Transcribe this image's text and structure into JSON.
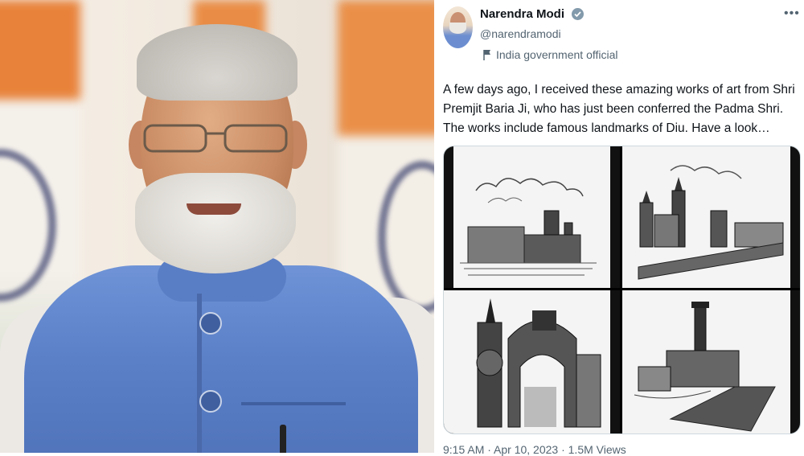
{
  "portrait": {
    "alt_subject": ""
  },
  "tweet": {
    "author_name": "Narendra Modi",
    "handle": "@narendramodi",
    "label": "India government official",
    "text": "A few days ago, I received these amazing works of art from Shri Premjit Baria Ji, who has just been conferred the Padma Shri. The works include famous landmarks of Diu. Have a look…",
    "timestamp": "9:15 AM · Apr 10, 2023 · 1.5M Views"
  },
  "icons": {
    "verified": "verified-badge-icon",
    "flag": "flag-icon",
    "more": "more-icon"
  },
  "colors": {
    "text": "#0f1419",
    "secondary": "#536471",
    "verified_badge": "#829aab",
    "jacket_blue": "#5b80c8"
  }
}
